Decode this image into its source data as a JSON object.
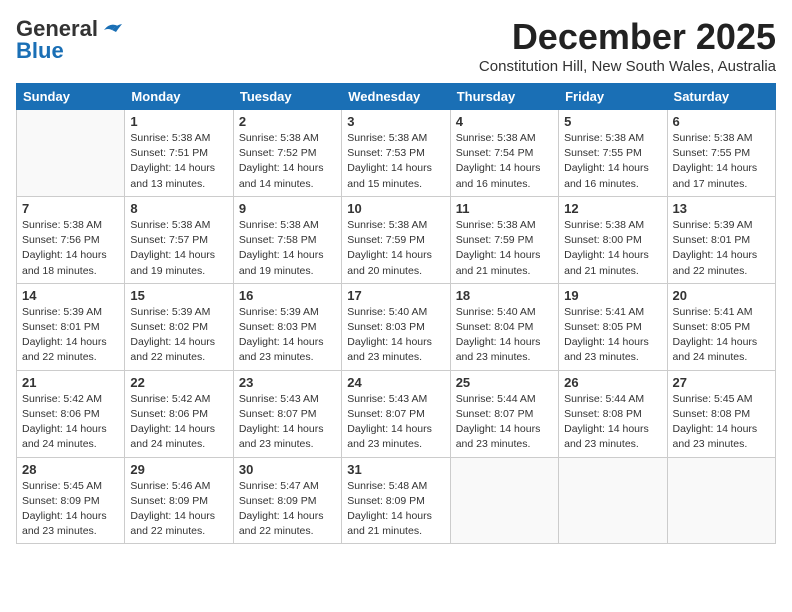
{
  "header": {
    "logo_general": "General",
    "logo_blue": "Blue",
    "month_title": "December 2025",
    "location": "Constitution Hill, New South Wales, Australia"
  },
  "days_of_week": [
    "Sunday",
    "Monday",
    "Tuesday",
    "Wednesday",
    "Thursday",
    "Friday",
    "Saturday"
  ],
  "weeks": [
    [
      {
        "day": "",
        "sunrise": "",
        "sunset": "",
        "daylight": ""
      },
      {
        "day": "1",
        "sunrise": "Sunrise: 5:38 AM",
        "sunset": "Sunset: 7:51 PM",
        "daylight": "Daylight: 14 hours and 13 minutes."
      },
      {
        "day": "2",
        "sunrise": "Sunrise: 5:38 AM",
        "sunset": "Sunset: 7:52 PM",
        "daylight": "Daylight: 14 hours and 14 minutes."
      },
      {
        "day": "3",
        "sunrise": "Sunrise: 5:38 AM",
        "sunset": "Sunset: 7:53 PM",
        "daylight": "Daylight: 14 hours and 15 minutes."
      },
      {
        "day": "4",
        "sunrise": "Sunrise: 5:38 AM",
        "sunset": "Sunset: 7:54 PM",
        "daylight": "Daylight: 14 hours and 16 minutes."
      },
      {
        "day": "5",
        "sunrise": "Sunrise: 5:38 AM",
        "sunset": "Sunset: 7:55 PM",
        "daylight": "Daylight: 14 hours and 16 minutes."
      },
      {
        "day": "6",
        "sunrise": "Sunrise: 5:38 AM",
        "sunset": "Sunset: 7:55 PM",
        "daylight": "Daylight: 14 hours and 17 minutes."
      }
    ],
    [
      {
        "day": "7",
        "sunrise": "Sunrise: 5:38 AM",
        "sunset": "Sunset: 7:56 PM",
        "daylight": "Daylight: 14 hours and 18 minutes."
      },
      {
        "day": "8",
        "sunrise": "Sunrise: 5:38 AM",
        "sunset": "Sunset: 7:57 PM",
        "daylight": "Daylight: 14 hours and 19 minutes."
      },
      {
        "day": "9",
        "sunrise": "Sunrise: 5:38 AM",
        "sunset": "Sunset: 7:58 PM",
        "daylight": "Daylight: 14 hours and 19 minutes."
      },
      {
        "day": "10",
        "sunrise": "Sunrise: 5:38 AM",
        "sunset": "Sunset: 7:59 PM",
        "daylight": "Daylight: 14 hours and 20 minutes."
      },
      {
        "day": "11",
        "sunrise": "Sunrise: 5:38 AM",
        "sunset": "Sunset: 7:59 PM",
        "daylight": "Daylight: 14 hours and 21 minutes."
      },
      {
        "day": "12",
        "sunrise": "Sunrise: 5:38 AM",
        "sunset": "Sunset: 8:00 PM",
        "daylight": "Daylight: 14 hours and 21 minutes."
      },
      {
        "day": "13",
        "sunrise": "Sunrise: 5:39 AM",
        "sunset": "Sunset: 8:01 PM",
        "daylight": "Daylight: 14 hours and 22 minutes."
      }
    ],
    [
      {
        "day": "14",
        "sunrise": "Sunrise: 5:39 AM",
        "sunset": "Sunset: 8:01 PM",
        "daylight": "Daylight: 14 hours and 22 minutes."
      },
      {
        "day": "15",
        "sunrise": "Sunrise: 5:39 AM",
        "sunset": "Sunset: 8:02 PM",
        "daylight": "Daylight: 14 hours and 22 minutes."
      },
      {
        "day": "16",
        "sunrise": "Sunrise: 5:39 AM",
        "sunset": "Sunset: 8:03 PM",
        "daylight": "Daylight: 14 hours and 23 minutes."
      },
      {
        "day": "17",
        "sunrise": "Sunrise: 5:40 AM",
        "sunset": "Sunset: 8:03 PM",
        "daylight": "Daylight: 14 hours and 23 minutes."
      },
      {
        "day": "18",
        "sunrise": "Sunrise: 5:40 AM",
        "sunset": "Sunset: 8:04 PM",
        "daylight": "Daylight: 14 hours and 23 minutes."
      },
      {
        "day": "19",
        "sunrise": "Sunrise: 5:41 AM",
        "sunset": "Sunset: 8:05 PM",
        "daylight": "Daylight: 14 hours and 23 minutes."
      },
      {
        "day": "20",
        "sunrise": "Sunrise: 5:41 AM",
        "sunset": "Sunset: 8:05 PM",
        "daylight": "Daylight: 14 hours and 24 minutes."
      }
    ],
    [
      {
        "day": "21",
        "sunrise": "Sunrise: 5:42 AM",
        "sunset": "Sunset: 8:06 PM",
        "daylight": "Daylight: 14 hours and 24 minutes."
      },
      {
        "day": "22",
        "sunrise": "Sunrise: 5:42 AM",
        "sunset": "Sunset: 8:06 PM",
        "daylight": "Daylight: 14 hours and 24 minutes."
      },
      {
        "day": "23",
        "sunrise": "Sunrise: 5:43 AM",
        "sunset": "Sunset: 8:07 PM",
        "daylight": "Daylight: 14 hours and 23 minutes."
      },
      {
        "day": "24",
        "sunrise": "Sunrise: 5:43 AM",
        "sunset": "Sunset: 8:07 PM",
        "daylight": "Daylight: 14 hours and 23 minutes."
      },
      {
        "day": "25",
        "sunrise": "Sunrise: 5:44 AM",
        "sunset": "Sunset: 8:07 PM",
        "daylight": "Daylight: 14 hours and 23 minutes."
      },
      {
        "day": "26",
        "sunrise": "Sunrise: 5:44 AM",
        "sunset": "Sunset: 8:08 PM",
        "daylight": "Daylight: 14 hours and 23 minutes."
      },
      {
        "day": "27",
        "sunrise": "Sunrise: 5:45 AM",
        "sunset": "Sunset: 8:08 PM",
        "daylight": "Daylight: 14 hours and 23 minutes."
      }
    ],
    [
      {
        "day": "28",
        "sunrise": "Sunrise: 5:45 AM",
        "sunset": "Sunset: 8:09 PM",
        "daylight": "Daylight: 14 hours and 23 minutes."
      },
      {
        "day": "29",
        "sunrise": "Sunrise: 5:46 AM",
        "sunset": "Sunset: 8:09 PM",
        "daylight": "Daylight: 14 hours and 22 minutes."
      },
      {
        "day": "30",
        "sunrise": "Sunrise: 5:47 AM",
        "sunset": "Sunset: 8:09 PM",
        "daylight": "Daylight: 14 hours and 22 minutes."
      },
      {
        "day": "31",
        "sunrise": "Sunrise: 5:48 AM",
        "sunset": "Sunset: 8:09 PM",
        "daylight": "Daylight: 14 hours and 21 minutes."
      },
      {
        "day": "",
        "sunrise": "",
        "sunset": "",
        "daylight": ""
      },
      {
        "day": "",
        "sunrise": "",
        "sunset": "",
        "daylight": ""
      },
      {
        "day": "",
        "sunrise": "",
        "sunset": "",
        "daylight": ""
      }
    ]
  ]
}
